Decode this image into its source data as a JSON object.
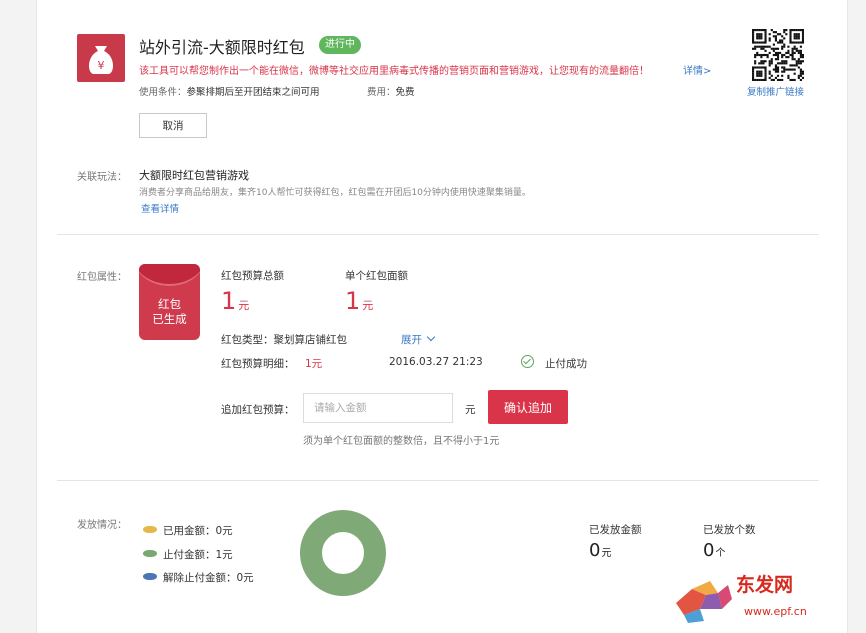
{
  "tool": {
    "title": "站外引流-大额限时红包",
    "status": "进行中",
    "description": "该工具可以帮您制作出一个能在微信，微博等社交应用里病毒式传播的营销页面和营销游戏，让您现有的流量翻倍！",
    "detail_link": "详情>",
    "condition_label": "使用条件：",
    "condition_value": "参聚排期后至开团结束之间可用",
    "fee_label": "费用：",
    "fee_value": "免费",
    "copy_link": "复制推广链接",
    "cancel_label": "取消"
  },
  "related": {
    "label": "关联玩法：",
    "title": "大额限时红包营销游戏",
    "desc": "消费者分享商品给朋友，集齐10人帮忙可获得红包，红包需在开团后10分钟内使用快速聚集销量。",
    "link": "查看详情"
  },
  "redpacket": {
    "label": "红包属性：",
    "envelope_line1": "红包",
    "envelope_line2": "已生成",
    "budget_label": "红包预算总额",
    "budget_value": "1",
    "budget_unit": "元",
    "single_label": "单个红包面额",
    "single_value": "1",
    "single_unit": "元",
    "type_label": "红包类型：",
    "type_value": "聚划算店铺红包",
    "expand_label": "展开",
    "detail_label": "红包预算明细：",
    "detail_amount": "1元",
    "detail_time": "2016.03.27 21:23",
    "detail_status": "止付成功",
    "add_label": "追加红包预算：",
    "input_placeholder": "请输入金额",
    "input_unit": "元",
    "confirm_label": "确认追加",
    "hint": "须为单个红包面额的整数倍，且不得小于1元"
  },
  "distribution": {
    "label": "发放情况：",
    "legend": [
      {
        "text": "已用金额：0元",
        "color": "#e6b84a"
      },
      {
        "text": "止付金额：1元",
        "color": "#7aa872"
      },
      {
        "text": "解除止付金额：0元",
        "color": "#4a77b4"
      }
    ],
    "donut_color": "#7fa976",
    "issued_amount_label": "已发放金额",
    "issued_amount_value": "0",
    "issued_amount_unit": "元",
    "issued_count_label": "已发放个数",
    "issued_count_value": "0",
    "issued_count_unit": "个"
  },
  "watermark": {
    "brand": "东发网",
    "url": "www.epf.cn"
  }
}
